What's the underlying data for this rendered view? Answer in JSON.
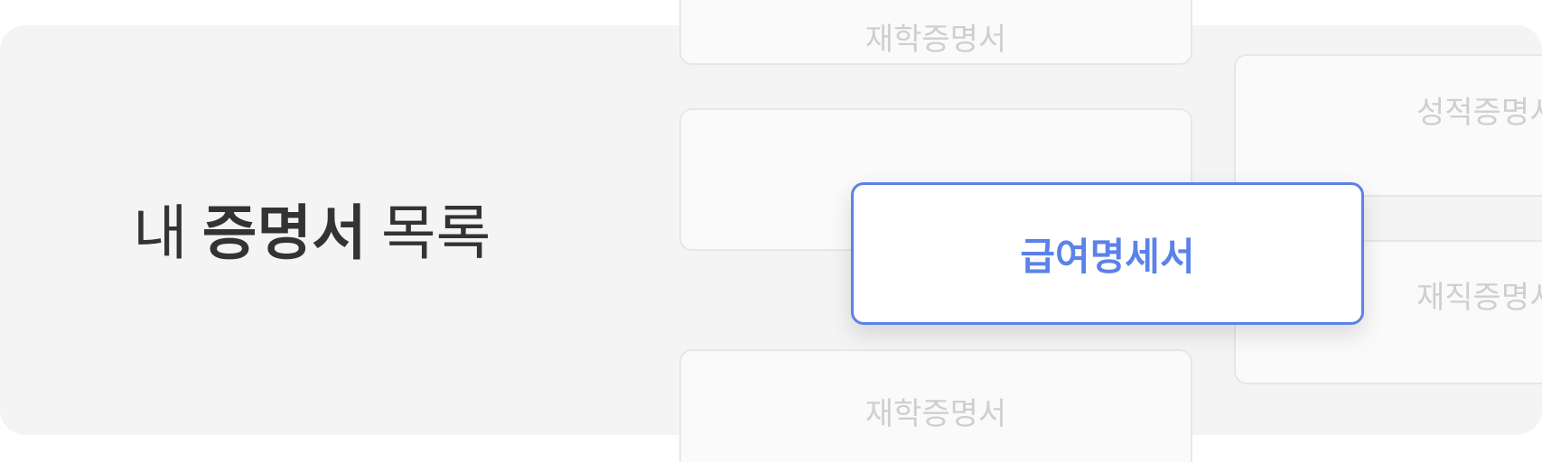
{
  "heading": {
    "prefix": "내",
    "emphasis": "증명서",
    "suffix": "목록"
  },
  "cards": {
    "top": "재학증명서",
    "middle": "성적증명서",
    "bottom": "재학증명서",
    "right_top": "성적증명서",
    "right_bottom": "재직증명서"
  },
  "active_card": {
    "label": "급여명세서"
  },
  "colors": {
    "accent": "#5b82e8",
    "panel_background": "#f4f4f4",
    "heading_text": "#333333",
    "faded_text": "#cfcfcf"
  }
}
